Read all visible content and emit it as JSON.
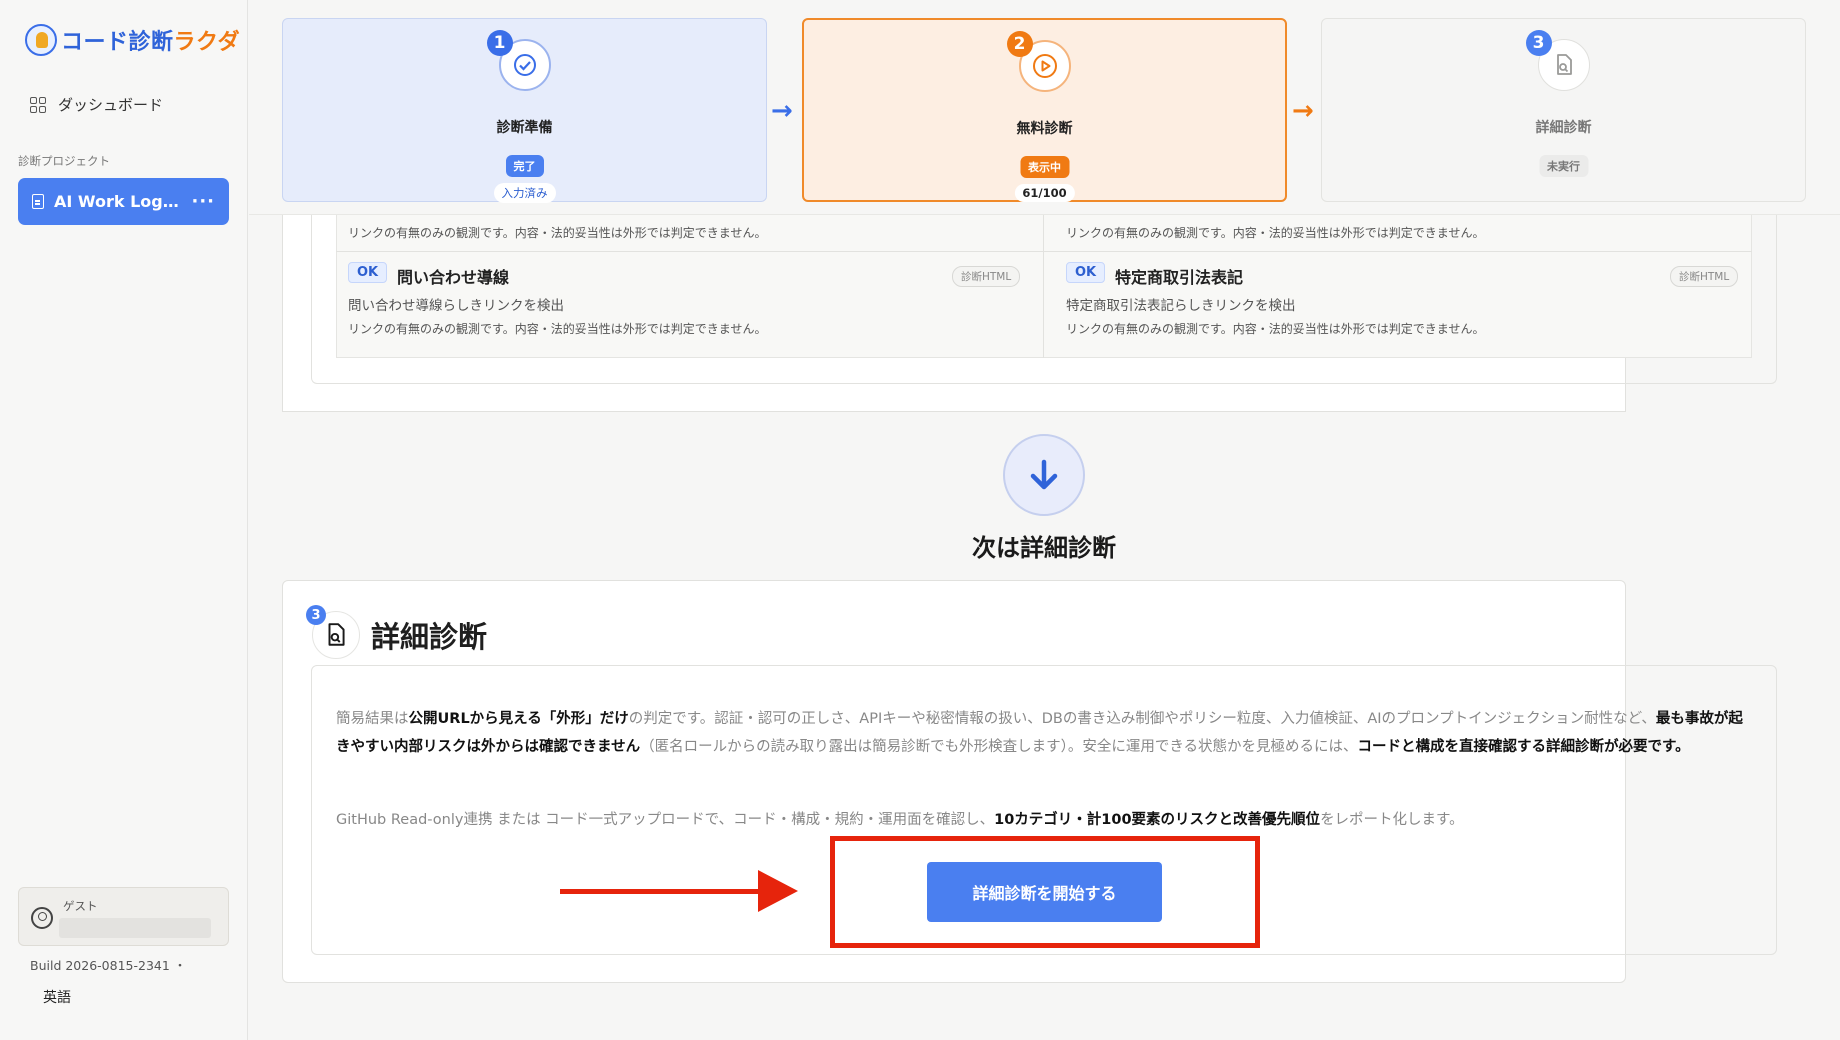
{
  "app": {
    "logo_left": "コード診断",
    "logo_right": "ラクダ"
  },
  "sidebar": {
    "dashboard": "ダッシュボード",
    "section_label": "診断プロジェクト",
    "project_name": "AI Work Log…",
    "project_menu": "···",
    "guest_label": "ゲスト",
    "build": "Build 2026-0815-2341 ・",
    "language": "英語"
  },
  "steps": [
    {
      "num": "1",
      "label": "診断準備",
      "status": "完了",
      "sub": "入力済み"
    },
    {
      "num": "2",
      "label": "無料診断",
      "status": "表示中",
      "sub": "61/100"
    },
    {
      "num": "3",
      "label": "詳細診断",
      "status": "未実行",
      "sub": ""
    }
  ],
  "checks": {
    "note": "リンクの有無のみの観測です。内容・法的妥当性は外形では判定できません。",
    "items": [
      {
        "badge": "OK",
        "title": "問い合わせ導線",
        "tag": "診断HTML",
        "desc": "問い合わせ導線らしきリンクを検出",
        "note": "リンクの有無のみの観測です。内容・法的妥当性は外形では判定できません。"
      },
      {
        "badge": "OK",
        "title": "特定商取引法表記",
        "tag": "診断HTML",
        "desc": "特定商取引法表記らしきリンクを検出",
        "note": "リンクの有無のみの観測です。内容・法的妥当性は外形では判定できません。"
      }
    ]
  },
  "next": {
    "title": "次は詳細診断"
  },
  "detail": {
    "num": "3",
    "title": "詳細診断",
    "p1_a": "簡易結果は",
    "p1_b": "公開URLから見える「外形」だけ",
    "p1_c": "の判定です。認証・認可の正しさ、APIキーや秘密情報の扱い、DBの書き込み制御やポリシー粒度、入力値検証、AIのプロンプトインジェクション耐性など、",
    "p1_d": "最も事故が起きやすい内部リスクは外からは確認できません",
    "p1_e": "（匿名ロールからの読み取り露出は簡易診断でも外形検査します）。安全に運用できる状態かを見極めるには、",
    "p1_f": "コードと構成を直接確認する詳細診断が必要です。",
    "p2_a": "GitHub Read-only連携 または コード一式アップロードで、コード・構成・規約・運用面を確認し、",
    "p2_b": "10カテゴリ・計100要素のリスクと改善優先順位",
    "p2_c": "をレポート化します。",
    "cta": "詳細診断を開始する"
  },
  "colors": {
    "accent": "#4a7ff0",
    "orange": "#f07a13",
    "annotation": "#e6240c"
  }
}
